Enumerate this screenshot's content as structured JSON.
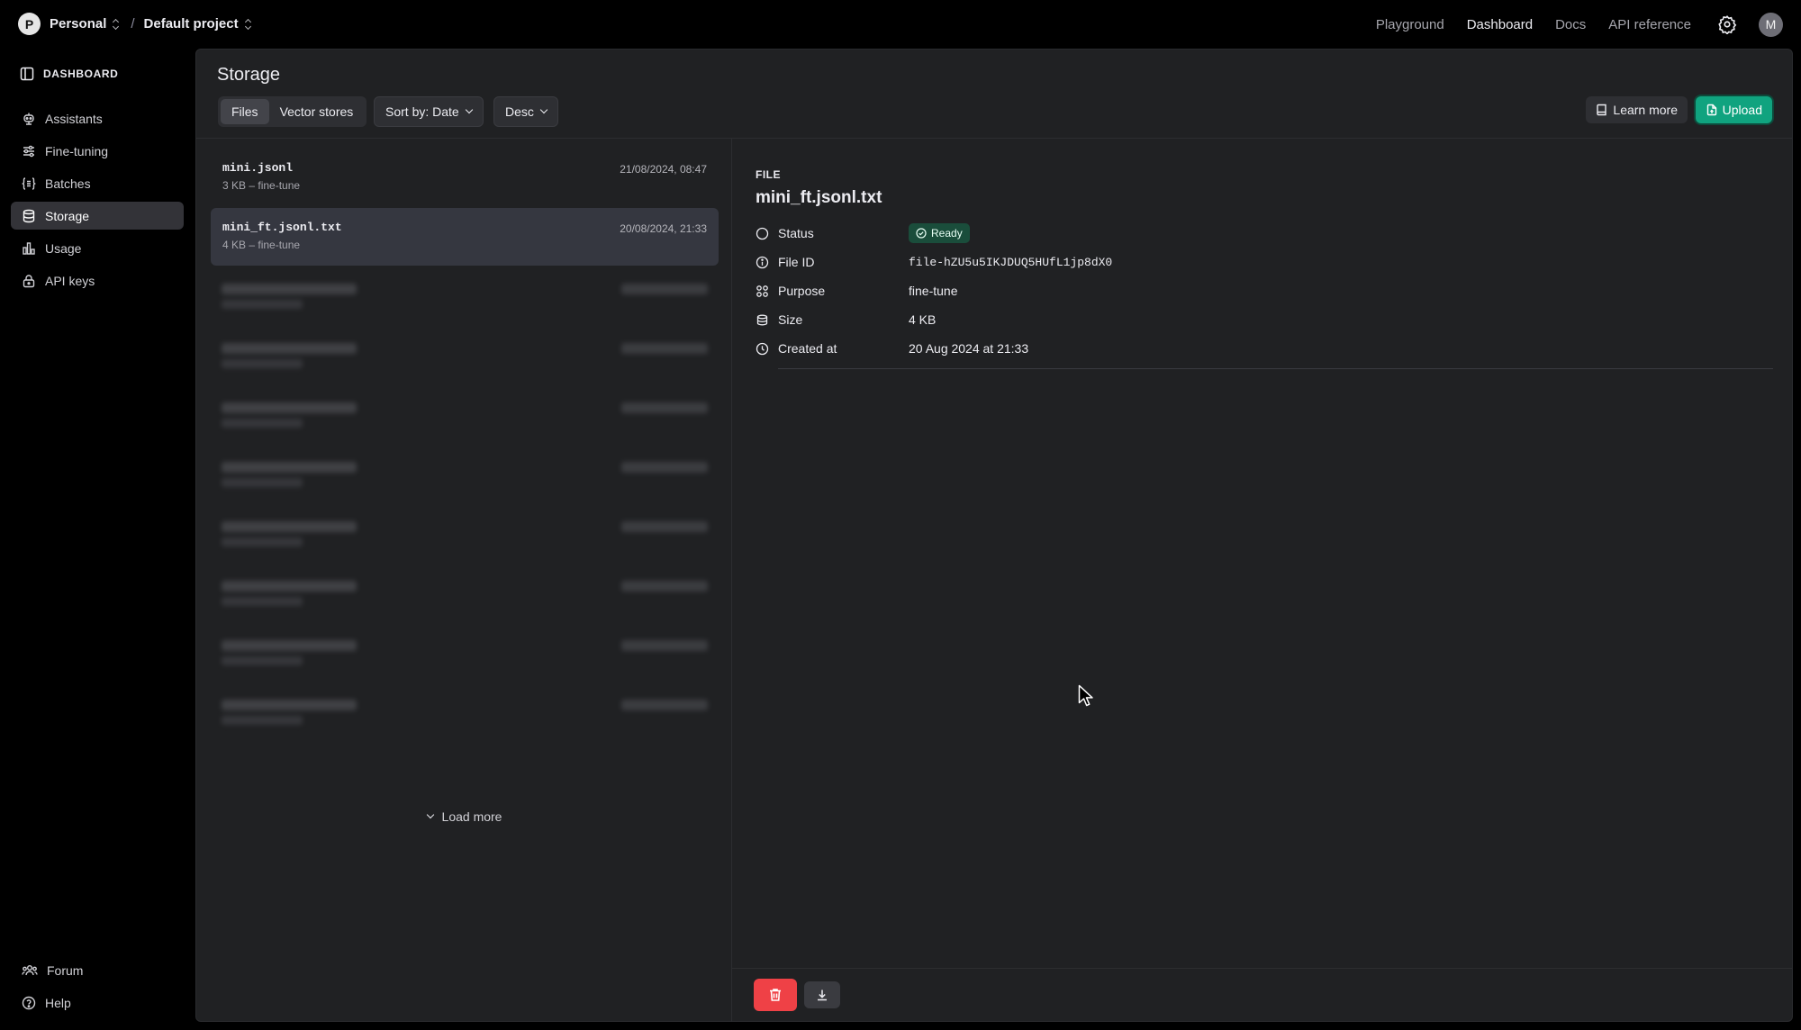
{
  "topbar": {
    "org_initial": "P",
    "org_name": "Personal",
    "separator": "/",
    "project_name": "Default project",
    "nav": [
      "Playground",
      "Dashboard",
      "Docs",
      "API reference"
    ],
    "active_nav": "Dashboard",
    "user_initial": "M"
  },
  "sidebar": {
    "heading": "DASHBOARD",
    "items": [
      {
        "label": "Assistants",
        "icon": "assistants-icon"
      },
      {
        "label": "Fine-tuning",
        "icon": "sliders-icon"
      },
      {
        "label": "Batches",
        "icon": "batches-icon"
      },
      {
        "label": "Storage",
        "icon": "database-icon",
        "active": true
      },
      {
        "label": "Usage",
        "icon": "bar-chart-icon"
      },
      {
        "label": "API keys",
        "icon": "lock-icon"
      }
    ],
    "footer": [
      {
        "label": "Forum",
        "icon": "people-icon"
      },
      {
        "label": "Help",
        "icon": "help-icon"
      }
    ]
  },
  "storage": {
    "title": "Storage",
    "tabs": [
      "Files",
      "Vector stores"
    ],
    "active_tab": "Files",
    "sort_label": "Sort by: Date",
    "order_label": "Desc",
    "learn_more": "Learn more",
    "upload": "Upload",
    "files": [
      {
        "name": "mini.jsonl",
        "meta": "3 KB – fine-tune",
        "date": "21/08/2024, 08:47"
      },
      {
        "name": "mini_ft.jsonl.txt",
        "meta": "4 KB – fine-tune",
        "date": "20/08/2024, 21:33",
        "selected": true
      }
    ],
    "load_more": "Load more"
  },
  "detail": {
    "label": "FILE",
    "title": "mini_ft.jsonl.txt",
    "status_label": "Status",
    "status_value": "Ready",
    "fileid_label": "File ID",
    "fileid_value": "file-hZU5u5IKJDUQ5HUfL1jp8dX0",
    "purpose_label": "Purpose",
    "purpose_value": "fine-tune",
    "size_label": "Size",
    "size_value": "4 KB",
    "created_label": "Created at",
    "created_value": "20 Aug 2024 at 21:33"
  },
  "colors": {
    "accent": "#10a37f",
    "danger": "#ef4146",
    "panel": "#202123"
  }
}
